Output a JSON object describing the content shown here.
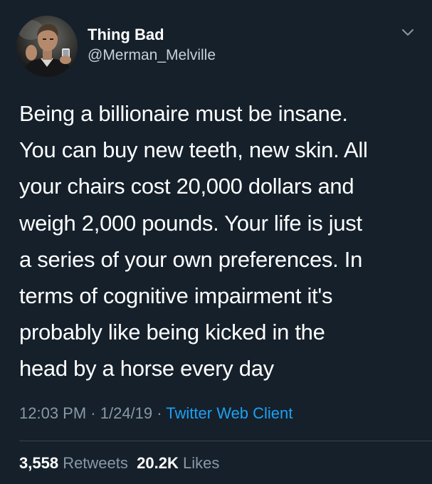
{
  "user": {
    "display_name": "Thing Bad",
    "handle": "@Merman_Melville",
    "avatar_icon": "person-with-phone-avatar"
  },
  "menu": {
    "icon": "chevron-down-icon"
  },
  "tweet": {
    "lines": [
      "Being a billionaire must be insane.",
      "You can buy new teeth, new skin. All",
      "your chairs cost 20,000 dollars and",
      "weigh 2,000 pounds. Your life is just",
      "a series of your own preferences. In",
      "terms of cognitive impairment it's",
      "probably like being kicked in the",
      "head by a horse every day"
    ]
  },
  "meta": {
    "time": "12:03 PM",
    "separator": " · ",
    "date": "1/24/19",
    "source": "Twitter Web Client"
  },
  "stats": {
    "retweets_count": "3,558",
    "retweets_label": "Retweets",
    "likes_count": "20.2K",
    "likes_label": "Likes"
  },
  "colors": {
    "background": "#15202b",
    "text_primary": "#ffffff",
    "text_secondary": "#8899a6",
    "link": "#1da1f2",
    "divider": "#38444d"
  }
}
